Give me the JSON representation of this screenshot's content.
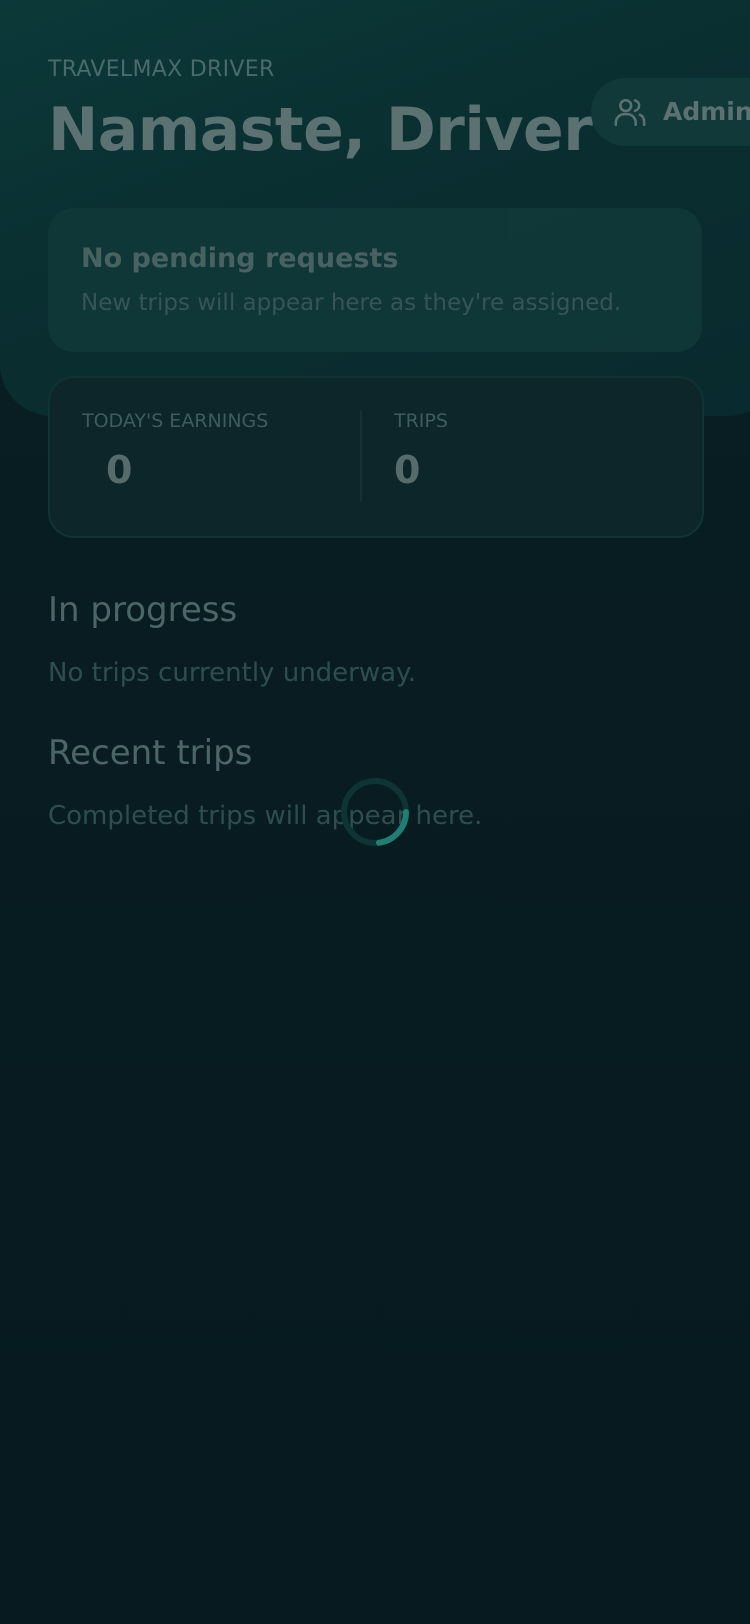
{
  "header": {
    "eyebrow": "TRAVELMAX DRIVER",
    "greeting": "Namaste, Driver",
    "admin_button": {
      "label": "Admin",
      "icon": "users-icon"
    }
  },
  "pending": {
    "title": "No pending requests",
    "subtitle": "New trips will appear here as they're assigned."
  },
  "stats": {
    "earnings_label": "TODAY'S EARNINGS",
    "earnings_value": "0",
    "trips_label": "TRIPS",
    "trips_value": "0"
  },
  "sections": {
    "in_progress_title": "In progress",
    "in_progress_empty": "No trips currently underway.",
    "recent_title": "Recent trips",
    "recent_empty": "Completed trips will appear here."
  },
  "colors": {
    "background": "#07181d",
    "hero": "#0c3a3a",
    "accent": "#2a9d8f"
  },
  "loading": {
    "icon": "loading-spinner-icon"
  }
}
